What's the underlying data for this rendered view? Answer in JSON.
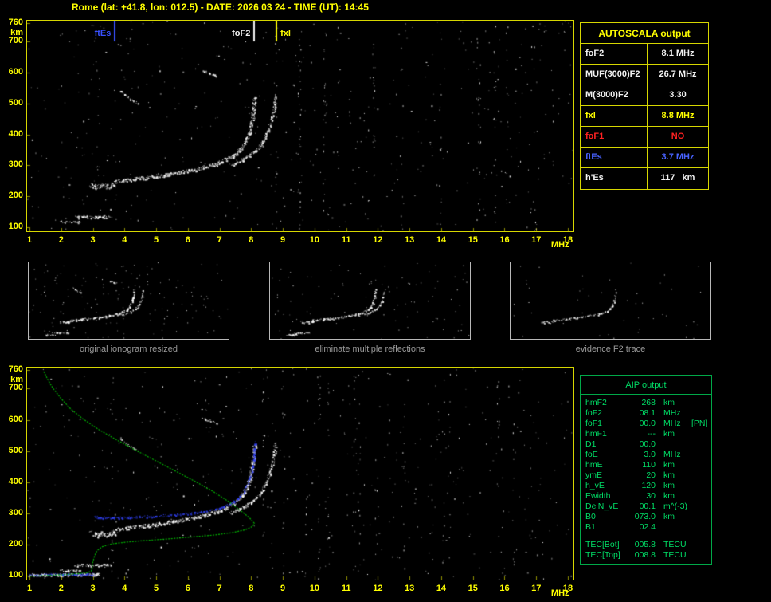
{
  "title": "Rome (lat: +41.8, lon: 012.5) - DATE: 2026 03 24 - TIME (UT): 14:45",
  "autoscala": {
    "header": "AUTOSCALA output",
    "border_color": "#d6d600",
    "rows": [
      {
        "label": "foF2",
        "value": "8.1 MHz",
        "color": "#f2f2f2"
      },
      {
        "label": "MUF(3000)F2",
        "value": "26.7 MHz",
        "color": "#f2f2f2"
      },
      {
        "label": "M(3000)F2",
        "value": "3.30",
        "color": "#f2f2f2"
      },
      {
        "label": "fxl",
        "value": "8.8 MHz",
        "color": "#ffff00"
      },
      {
        "label": "foF1",
        "value": "NO",
        "color": "#ff2222"
      },
      {
        "label": "ftEs",
        "value": "3.7 MHz",
        "color": "#4862ff"
      },
      {
        "label": "h'Es",
        "value": "117   km",
        "color": "#f2f2f2"
      }
    ]
  },
  "aip": {
    "header": "AIP output",
    "text_color": "#00dd66",
    "border_color": "#00a848",
    "rows": [
      {
        "name": "hmF2",
        "value": "268",
        "unit": "km",
        "note": ""
      },
      {
        "name": "foF2",
        "value": "08.1",
        "unit": "MHz",
        "note": ""
      },
      {
        "name": "foF1",
        "value": "00.0",
        "unit": "MHz",
        "note": "[PN]"
      },
      {
        "name": "hmF1",
        "value": "---",
        "unit": "km",
        "note": ""
      },
      {
        "name": "D1",
        "value": "00.0",
        "unit": "",
        "note": ""
      },
      {
        "name": "foE",
        "value": "3.0",
        "unit": "MHz",
        "note": ""
      },
      {
        "name": "hmE",
        "value": "110",
        "unit": "km",
        "note": ""
      },
      {
        "name": "ymE",
        "value": "20",
        "unit": "km",
        "note": ""
      },
      {
        "name": "h_vE",
        "value": "120",
        "unit": "km",
        "note": ""
      },
      {
        "name": "Ewidth",
        "value": "30",
        "unit": "km",
        "note": ""
      },
      {
        "name": "DelN_vE",
        "value": "00.1",
        "unit": "m^(-3)",
        "note": ""
      },
      {
        "name": "B0",
        "value": "073.0",
        "unit": "km",
        "note": ""
      },
      {
        "name": "B1",
        "value": "02.4",
        "unit": "",
        "note": ""
      }
    ],
    "tec_rows": [
      {
        "name": "TEC[Bot]",
        "value": "005.8",
        "unit": "TECU",
        "note": ""
      },
      {
        "name": "TEC[Top]",
        "value": "008.8",
        "unit": "TECU",
        "note": ""
      }
    ]
  },
  "thumbnails": [
    {
      "caption": "original ionogram resized"
    },
    {
      "caption": "eliminate multiple reflections"
    },
    {
      "caption": "evidence F2 trace"
    }
  ],
  "chart_data": [
    {
      "type": "scatter",
      "name": "ionogram with AUTOSCALA markers",
      "xlabel": "MHz",
      "ylabel": "km",
      "xlim": [
        1,
        18
      ],
      "ylim": [
        100,
        760
      ],
      "xticks": [
        1,
        2,
        3,
        4,
        5,
        6,
        7,
        8,
        9,
        10,
        11,
        12,
        13,
        14,
        15,
        16,
        17,
        18
      ],
      "yticks": [
        760,
        700,
        600,
        500,
        400,
        300,
        200,
        100
      ],
      "markers": [
        {
          "label": "ftEs",
          "freq": 3.7,
          "color": "#3850ff",
          "label_side": "left"
        },
        {
          "label": "foF2",
          "freq": 8.1,
          "color": "#f0f0f0",
          "label_side": "left"
        },
        {
          "label": "fxl",
          "freq": 8.8,
          "color": "#ffff00",
          "label_side": "right"
        }
      ],
      "traces": {
        "f_ordinary": [
          [
            3.75,
            249
          ],
          [
            4.1,
            254
          ],
          [
            4.5,
            259
          ],
          [
            4.9,
            264
          ],
          [
            5.3,
            270
          ],
          [
            5.7,
            277
          ],
          [
            6.1,
            285
          ],
          [
            6.5,
            295
          ],
          [
            6.9,
            306
          ],
          [
            7.2,
            319
          ],
          [
            7.45,
            334
          ],
          [
            7.65,
            352
          ],
          [
            7.8,
            374
          ],
          [
            7.92,
            400
          ],
          [
            8.0,
            432
          ],
          [
            8.06,
            468
          ],
          [
            8.09,
            500
          ],
          [
            8.11,
            523
          ]
        ],
        "f_extraordinary": [
          [
            7.35,
            302
          ],
          [
            7.6,
            313
          ],
          [
            7.85,
            327
          ],
          [
            8.1,
            344
          ],
          [
            8.3,
            365
          ],
          [
            8.45,
            392
          ],
          [
            8.57,
            425
          ],
          [
            8.66,
            458
          ],
          [
            8.72,
            490
          ],
          [
            8.76,
            523
          ]
        ],
        "f_start_cluster": [
          [
            2.95,
            237
          ],
          [
            3.1,
            231
          ],
          [
            3.3,
            236
          ],
          [
            3.5,
            231
          ],
          [
            3.65,
            238
          ],
          [
            3.75,
            246
          ]
        ],
        "es_layer": [
          [
            2.45,
            133
          ],
          [
            2.7,
            135
          ],
          [
            3.0,
            133
          ],
          [
            3.3,
            135
          ],
          [
            3.55,
            134
          ]
        ],
        "es_layer2": [
          [
            1.95,
            119
          ],
          [
            2.15,
            117
          ],
          [
            2.4,
            118
          ],
          [
            2.6,
            117
          ]
        ],
        "second_hop_a": [
          [
            3.85,
            543
          ],
          [
            4.1,
            521
          ],
          [
            4.4,
            502
          ]
        ],
        "second_hop_b": [
          [
            6.45,
            608
          ],
          [
            6.7,
            597
          ],
          [
            6.9,
            589
          ]
        ]
      },
      "noise": {
        "seed": 11,
        "dots": 430,
        "strips": 16
      }
    },
    {
      "type": "scatter",
      "name": "ionogram with AIP restored trace and electron density profile",
      "xlabel": "MHz",
      "ylabel": "km",
      "xlim": [
        1,
        18
      ],
      "ylim": [
        100,
        760
      ],
      "xticks": [
        1,
        2,
        3,
        4,
        5,
        6,
        7,
        8,
        9,
        10,
        11,
        12,
        13,
        14,
        15,
        16,
        17,
        18
      ],
      "yticks": [
        760,
        700,
        600,
        500,
        400,
        300,
        200,
        100
      ],
      "restored_color": "#3344ff",
      "profile_color": "#00b400",
      "restored_trace": [
        [
          3.05,
          289
        ],
        [
          3.4,
          287
        ],
        [
          3.8,
          287
        ],
        [
          4.2,
          288
        ],
        [
          4.6,
          290
        ],
        [
          5.0,
          292
        ],
        [
          5.4,
          295
        ],
        [
          5.8,
          298
        ],
        [
          6.2,
          302
        ],
        [
          6.6,
          308
        ],
        [
          7.0,
          317
        ],
        [
          7.3,
          329
        ],
        [
          7.55,
          345
        ],
        [
          7.75,
          368
        ],
        [
          7.9,
          398
        ],
        [
          8.0,
          432
        ],
        [
          8.07,
          470
        ],
        [
          8.1,
          505
        ],
        [
          8.12,
          530
        ]
      ],
      "restored_es": [
        [
          1.0,
          104
        ],
        [
          1.35,
          103
        ],
        [
          1.7,
          105
        ],
        [
          2.05,
          104
        ],
        [
          2.4,
          105
        ],
        [
          2.75,
          104
        ],
        [
          3.05,
          106
        ]
      ],
      "extra_es_white": [
        [
          1.0,
          103
        ],
        [
          1.5,
          104
        ],
        [
          2.0,
          103
        ],
        [
          2.5,
          105
        ],
        [
          3.0,
          104
        ],
        [
          3.2,
          105
        ]
      ],
      "profile_green": [
        [
          1.45,
          755
        ],
        [
          1.6,
          725
        ],
        [
          1.75,
          700
        ],
        [
          2.0,
          668
        ],
        [
          2.3,
          635
        ],
        [
          2.7,
          602
        ],
        [
          3.2,
          568
        ],
        [
          3.8,
          533
        ],
        [
          4.4,
          500
        ],
        [
          5.0,
          468
        ],
        [
          5.6,
          436
        ],
        [
          6.2,
          404
        ],
        [
          6.8,
          370
        ],
        [
          7.3,
          337
        ],
        [
          7.7,
          306
        ],
        [
          7.95,
          285
        ],
        [
          8.1,
          268
        ],
        [
          8.05,
          258
        ],
        [
          7.8,
          247
        ],
        [
          7.4,
          238
        ],
        [
          6.8,
          230
        ],
        [
          6.1,
          224
        ],
        [
          5.4,
          218
        ],
        [
          4.7,
          213
        ],
        [
          4.1,
          208
        ],
        [
          3.6,
          202
        ],
        [
          3.3,
          193
        ],
        [
          3.13,
          180
        ],
        [
          3.05,
          162
        ],
        [
          3.0,
          143
        ],
        [
          2.98,
          126
        ],
        [
          2.95,
          114
        ],
        [
          2.8,
          109
        ],
        [
          2.5,
          106
        ],
        [
          2.1,
          103
        ],
        [
          1.7,
          101
        ],
        [
          1.3,
          99
        ],
        [
          1.0,
          98
        ]
      ],
      "noise": {
        "seed": 29,
        "dots": 430,
        "strips": 16
      }
    }
  ]
}
